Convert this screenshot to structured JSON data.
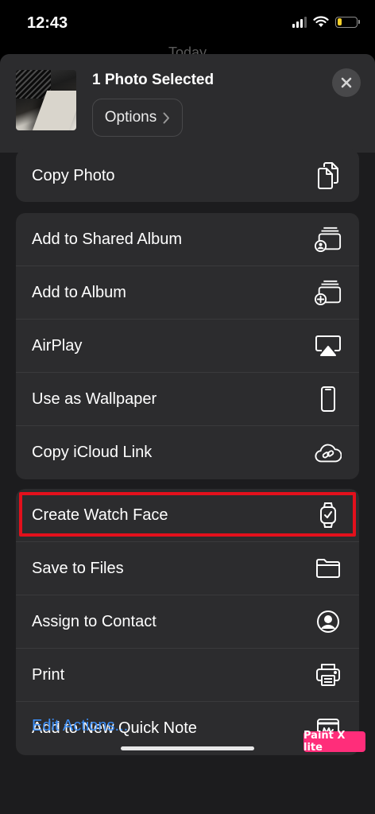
{
  "status_bar": {
    "time": "12:43",
    "battery_level": 0.25,
    "battery_color": "#f7d12b"
  },
  "background": {
    "peek_text": "Today"
  },
  "share_sheet": {
    "title": "1 Photo Selected",
    "options_label": "Options",
    "close_icon": "xmark-icon"
  },
  "groups": [
    {
      "items": [
        {
          "label": "Copy Photo",
          "icon": "copy-icon"
        }
      ]
    },
    {
      "items": [
        {
          "label": "Add to Shared Album",
          "icon": "shared-album-icon"
        },
        {
          "label": "Add to Album",
          "icon": "add-album-icon"
        },
        {
          "label": "AirPlay",
          "icon": "airplay-icon"
        },
        {
          "label": "Use as Wallpaper",
          "icon": "phone-icon"
        },
        {
          "label": "Copy iCloud Link",
          "icon": "icloud-link-icon"
        }
      ]
    },
    {
      "items": [
        {
          "label": "Create Watch Face",
          "icon": "watch-icon"
        },
        {
          "label": "Save to Files",
          "icon": "folder-icon",
          "highlighted": true
        },
        {
          "label": "Assign to Contact",
          "icon": "contact-icon"
        },
        {
          "label": "Print",
          "icon": "printer-icon"
        },
        {
          "label": "Add to New Quick Note",
          "icon": "quick-note-icon"
        }
      ]
    }
  ],
  "footer": {
    "edit_actions": "Edit Actions..."
  },
  "watermark": "Paint X lite",
  "colors": {
    "highlight": "#e3101c",
    "link": "#3b8df5"
  }
}
